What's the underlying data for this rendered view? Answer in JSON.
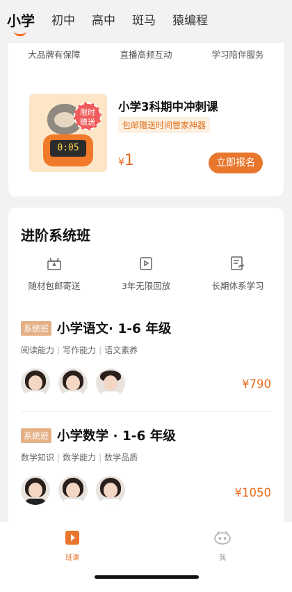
{
  "top_tabs": [
    "小学",
    "初中",
    "高中",
    "斑马",
    "猿编程"
  ],
  "active_tab": "小学",
  "promo_card": {
    "benefits": [
      "大品牌有保障",
      "直播高频互动",
      "学习陪伴服务"
    ],
    "image_badge": "限时\n赠送",
    "clock_text": "0:05",
    "title": "小学3科期中冲刺课",
    "subtitle": "包邮赠送时间管家神器",
    "currency": "¥",
    "price": "1",
    "button": "立即报名"
  },
  "system_class": {
    "title": "进阶系统班",
    "features": [
      {
        "label": "随材包邮寄送",
        "icon": "gift-box-icon"
      },
      {
        "label": "3年无限回放",
        "icon": "replay-icon"
      },
      {
        "label": "长期体系学习",
        "icon": "study-chart-icon"
      }
    ],
    "courses": [
      {
        "tag": "系统班",
        "title": "小学语文· 1-6 年级",
        "skills": [
          "阅读能力",
          "写作能力",
          "语文素养"
        ],
        "price": "¥790"
      },
      {
        "tag": "系统班",
        "title": "小学数学 · 1-6 年级",
        "skills": [
          "数学知识",
          "数学能力",
          "数学品质"
        ],
        "price": "¥1050"
      }
    ]
  },
  "bottom_nav": [
    {
      "label": "班课",
      "icon": "play-class-icon",
      "active": true
    },
    {
      "label": "我",
      "icon": "profile-icon",
      "active": false
    }
  ],
  "colors": {
    "accent": "#e8762c",
    "price": "#ea6a1a",
    "tag": "#e4b086"
  }
}
